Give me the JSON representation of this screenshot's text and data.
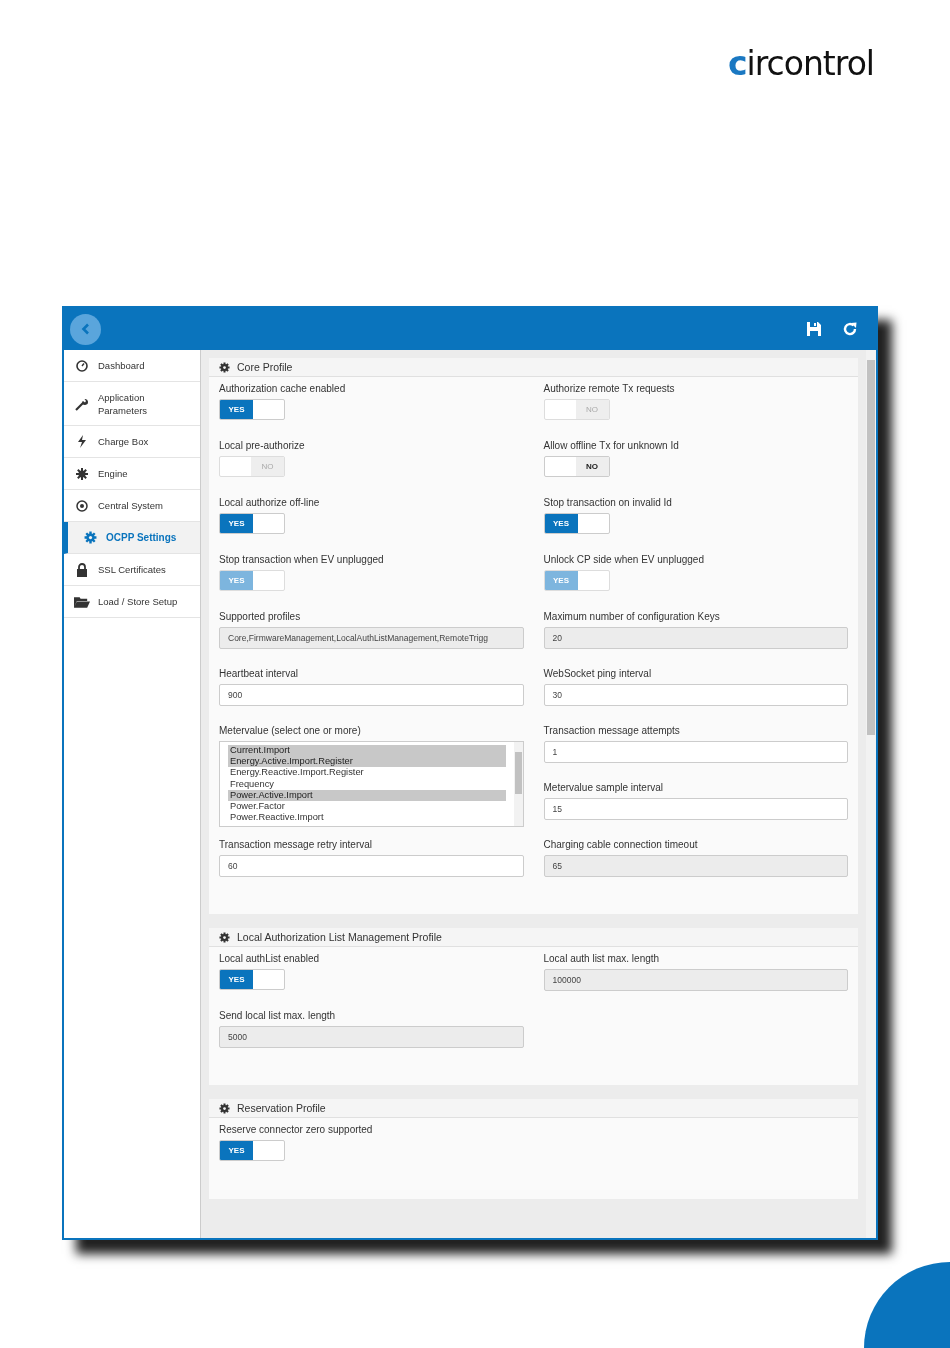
{
  "logo": {
    "text": "circontrol"
  },
  "sidebar": {
    "items": [
      {
        "label": "Dashboard",
        "selected": false
      },
      {
        "label": "Application Parameters",
        "selected": false
      },
      {
        "label": "Charge Box",
        "selected": false
      },
      {
        "label": "Engine",
        "selected": false
      },
      {
        "label": "Central System",
        "selected": false
      },
      {
        "label": "OCPP Settings",
        "selected": true
      },
      {
        "label": "SSL Certificates",
        "selected": false
      },
      {
        "label": "Load / Store Setup",
        "selected": false
      }
    ]
  },
  "sections": [
    {
      "title": "Core Profile",
      "rows": [
        {
          "left": [
            {
              "kind": "toggle",
              "label": "Authorization cache enabled",
              "on": true,
              "disabled": false,
              "text": "YES"
            }
          ],
          "right": [
            {
              "kind": "toggle",
              "label": "Authorize remote Tx requests",
              "on": false,
              "disabled": true,
              "text": "NO"
            }
          ]
        },
        {
          "left": [
            {
              "kind": "toggle",
              "label": "Local pre-authorize",
              "on": false,
              "disabled": true,
              "text": "NO"
            }
          ],
          "right": [
            {
              "kind": "toggle",
              "label": "Allow offline Tx for unknown Id",
              "on": false,
              "disabled": false,
              "text": "NO"
            }
          ]
        },
        {
          "left": [
            {
              "kind": "toggle",
              "label": "Local authorize off-line",
              "on": true,
              "disabled": false,
              "text": "YES"
            }
          ],
          "right": [
            {
              "kind": "toggle",
              "label": "Stop transaction on invalid Id",
              "on": true,
              "disabled": false,
              "text": "YES"
            }
          ]
        },
        {
          "left": [
            {
              "kind": "toggle",
              "label": "Stop transaction when EV unplugged",
              "on": true,
              "disabled": true,
              "text": "YES"
            }
          ],
          "right": [
            {
              "kind": "toggle",
              "label": "Unlock CP side when EV unplugged",
              "on": true,
              "disabled": true,
              "text": "YES"
            }
          ]
        },
        {
          "left": [
            {
              "kind": "field",
              "label": "Supported profiles",
              "value": "Core,FirmwareManagement,LocalAuthListManagement,RemoteTrigg",
              "readonly": true
            }
          ],
          "right": [
            {
              "kind": "field",
              "label": "Maximum number of configuration Keys",
              "value": "20",
              "readonly": true
            }
          ]
        },
        {
          "left": [
            {
              "kind": "field",
              "label": "Heartbeat interval",
              "value": "900",
              "readonly": false
            }
          ],
          "right": [
            {
              "kind": "field",
              "label": "WebSocket ping interval",
              "value": "30",
              "readonly": false
            }
          ]
        },
        {
          "left": [
            {
              "kind": "listbox",
              "label": "Metervalue (select one or more)",
              "options": [
                {
                  "text": "Current.Import",
                  "selected": true
                },
                {
                  "text": "Energy.Active.Import.Register",
                  "selected": true
                },
                {
                  "text": "Energy.Reactive.Import.Register",
                  "selected": false
                },
                {
                  "text": "Frequency",
                  "selected": false
                },
                {
                  "text": "Power.Active.Import",
                  "selected": true
                },
                {
                  "text": "Power.Factor",
                  "selected": false
                },
                {
                  "text": "Power.Reactive.Import",
                  "selected": false
                }
              ]
            }
          ],
          "right": [
            {
              "kind": "field",
              "label": "Transaction message attempts",
              "value": "1",
              "readonly": false
            },
            {
              "kind": "field",
              "label": "Metervalue sample interval",
              "value": "15",
              "readonly": false
            }
          ]
        },
        {
          "left": [
            {
              "kind": "field",
              "label": "Transaction message retry interval",
              "value": "60",
              "readonly": false
            }
          ],
          "right": [
            {
              "kind": "field",
              "label": "Charging cable connection timeout",
              "value": "65",
              "readonly": true
            }
          ]
        }
      ]
    },
    {
      "title": "Local Authorization List Management Profile",
      "rows": [
        {
          "left": [
            {
              "kind": "toggle",
              "label": "Local authList enabled",
              "on": true,
              "disabled": false,
              "text": "YES"
            }
          ],
          "right": [
            {
              "kind": "field",
              "label": "Local auth list max. length",
              "value": "100000",
              "readonly": true
            }
          ]
        },
        {
          "left": [
            {
              "kind": "field",
              "label": "Send local list max. length",
              "value": "5000",
              "readonly": true
            }
          ],
          "right": []
        }
      ]
    },
    {
      "title": "Reservation Profile",
      "rows": [
        {
          "left": [
            {
              "kind": "toggle",
              "label": "Reserve connector zero supported",
              "on": true,
              "disabled": false,
              "text": "YES"
            }
          ],
          "right": []
        }
      ]
    }
  ]
}
